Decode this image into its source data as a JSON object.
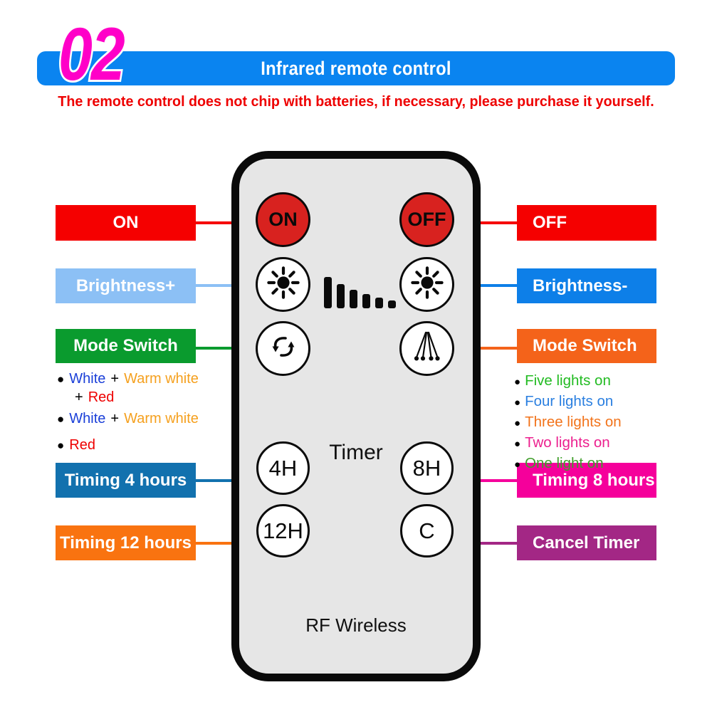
{
  "header": {
    "number": "02",
    "title": "Infrared remote control",
    "subtitle": "The remote control does not chip with batteries, if necessary, please purchase it yourself.",
    "bar_color": "#0a84f0",
    "number_color": "#ff00c8",
    "subtitle_color": "#ee0000"
  },
  "remote": {
    "footer_label": "RF Wireless",
    "timer_label": "Timer",
    "body_color": "#e6e6e6",
    "border_color": "#0a0a0a",
    "buttons": {
      "on": "ON",
      "off": "OFF",
      "brightness_up": "brightness-up-sun-icon",
      "brightness_down": "brightness-down-sun-icon",
      "mode_left": "cycle-arrows-icon",
      "mode_right": "light-rays-icon",
      "timer_4h": "4H",
      "timer_8h": "8H",
      "timer_12h": "12H",
      "timer_cancel": "C"
    },
    "brightness_bars": [
      44,
      34,
      26,
      20,
      15,
      11
    ]
  },
  "labels": {
    "left": [
      {
        "text": "ON",
        "color": "#f50000"
      },
      {
        "text": "Brightness+",
        "color": "#8cc0f5"
      },
      {
        "text": "Mode Switch",
        "color": "#0a9b2e"
      },
      {
        "text": "Timing 4 hours",
        "color": "#1271ae"
      },
      {
        "text": "Timing 12 hours",
        "color": "#f97310"
      }
    ],
    "right": [
      {
        "text": "OFF",
        "color": "#f50000"
      },
      {
        "text": "Brightness-",
        "color": "#0d7fe8"
      },
      {
        "text": "Mode Switch",
        "color": "#f4631a"
      },
      {
        "text": "Timing 8 hours",
        "color": "#f5009b"
      },
      {
        "text": "Cancel Timer",
        "color": "#a32785"
      }
    ]
  },
  "mode_left_list": [
    {
      "parts": [
        {
          "t": "White",
          "c": "blue"
        },
        {
          "t": "+",
          "c": "black"
        },
        {
          "t": "Warm white",
          "c": "orange"
        }
      ],
      "indent": false
    },
    {
      "parts": [
        {
          "t": "+",
          "c": "black"
        },
        {
          "t": "Red",
          "c": "red"
        }
      ],
      "indent": true
    },
    {
      "parts": [
        {
          "t": "White",
          "c": "blue"
        },
        {
          "t": "+",
          "c": "black"
        },
        {
          "t": "Warm white",
          "c": "orange"
        }
      ],
      "indent": false
    },
    {
      "parts": [
        {
          "t": "Red",
          "c": "red"
        }
      ],
      "indent": false
    }
  ],
  "mode_right_list": [
    {
      "text": "Five lights on",
      "color": "#22bb22"
    },
    {
      "text": "Four lights on",
      "color": "#2a7fe0"
    },
    {
      "text": "Three lights on",
      "color": "#f2731a"
    },
    {
      "text": "Two lights on",
      "color": "#ec1f8e"
    },
    {
      "text": "One light on",
      "color": "#3f9e2a"
    }
  ]
}
